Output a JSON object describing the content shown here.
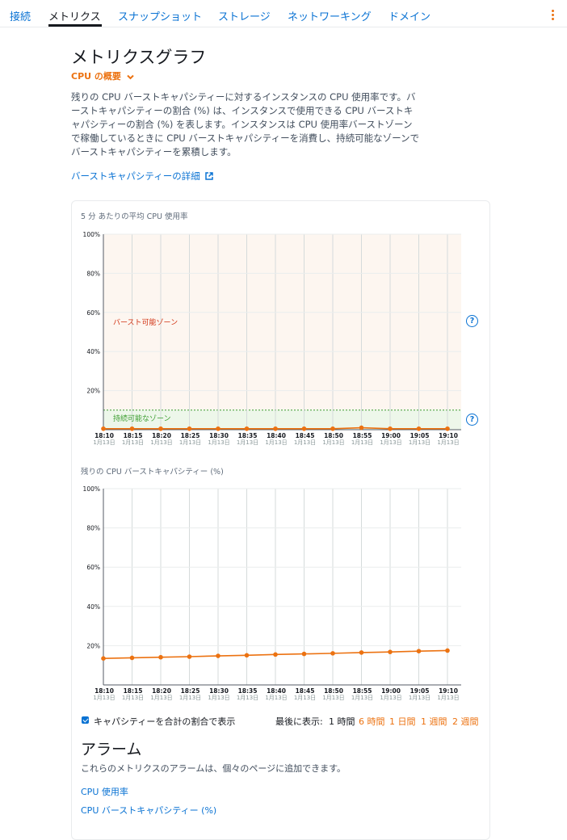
{
  "tabs": [
    {
      "label": "接続",
      "active": false
    },
    {
      "label": "メトリクス",
      "active": true
    },
    {
      "label": "スナップショット",
      "active": false
    },
    {
      "label": "ストレージ",
      "active": false
    },
    {
      "label": "ネットワーキング",
      "active": false
    },
    {
      "label": "ドメイン",
      "active": false
    }
  ],
  "section": {
    "title": "メトリクスグラフ",
    "dropdown_label": "CPU の概要",
    "description": "残りの CPU バーストキャパシティーに対するインスタンスの CPU 使用率です。バーストキャパシティーの割合 (%) は、インスタンスで使用できる CPU バーストキャパシティーの割合 (%) を表します。インスタンスは CPU 使用率バーストゾーンで稼働しているときに CPU バーストキャパシティーを消費し、持続可能なゾーンでバーストキャパシティーを累積します。",
    "detail_link": "バーストキャパシティーの詳細"
  },
  "chart_data": [
    {
      "type": "line",
      "title": "5 分 あたりの平均 CPU 使用率",
      "x": [
        "18:10",
        "18:15",
        "18:20",
        "18:25",
        "18:30",
        "18:35",
        "18:40",
        "18:45",
        "18:50",
        "18:55",
        "19:00",
        "19:05",
        "19:10"
      ],
      "x_sublabel": "1月13日",
      "y_ticks": [
        "20%",
        "40%",
        "60%",
        "80%",
        "100%"
      ],
      "ylim": [
        0,
        100
      ],
      "values": [
        0.5,
        0.5,
        0.5,
        0.5,
        0.5,
        0.5,
        0.5,
        0.5,
        0.5,
        1,
        0.5,
        0.5,
        0.5
      ],
      "zones": {
        "burst": "バースト可能ゾーン",
        "sustainable": "持続可能なゾーン",
        "sustainable_threshold": 10
      },
      "colors": {
        "line": "#ec7211",
        "burst_bg": "#fdf6f0",
        "sustainable_bg": "#edf7ea",
        "sustainable_line": "#3a9c2f",
        "burst_text": "#d13212"
      }
    },
    {
      "type": "line",
      "title": "残りの CPU バーストキャパシティー (%)",
      "x": [
        "18:10",
        "18:15",
        "18:20",
        "18:25",
        "18:30",
        "18:35",
        "18:40",
        "18:45",
        "18:50",
        "18:55",
        "19:00",
        "19:05",
        "19:10"
      ],
      "x_sublabel": "1月13日",
      "y_ticks": [
        "20%",
        "40%",
        "60%",
        "80%",
        "100%"
      ],
      "ylim": [
        0,
        100
      ],
      "values": [
        13.5,
        13.8,
        14.1,
        14.4,
        14.8,
        15.1,
        15.5,
        15.8,
        16.1,
        16.5,
        16.8,
        17.2,
        17.5
      ],
      "colors": {
        "line": "#ec7211"
      }
    }
  ],
  "options": {
    "checkbox_label": "キャパシティーを合計の割合で表示",
    "checkbox_checked": true,
    "range_prefix": "最後に表示:",
    "ranges": [
      {
        "label": "1 時間",
        "selected": true
      },
      {
        "label": "6 時間",
        "selected": false
      },
      {
        "label": "1 日間",
        "selected": false
      },
      {
        "label": "1 週間",
        "selected": false
      },
      {
        "label": "2 週間",
        "selected": false
      }
    ]
  },
  "alarms": {
    "title": "アラーム",
    "description": "これらのメトリクスのアラームは、個々のページに追加できます。",
    "links": [
      "CPU 使用率",
      "CPU バーストキャパシティー (%)"
    ]
  },
  "icons": {
    "help": "?",
    "more": "more-vertical-icon",
    "external": "external-link-icon",
    "chevron": "chevron-down-icon"
  },
  "colors": {
    "accent": "#ec7211",
    "link": "#0972d3",
    "text": "#16191f"
  }
}
